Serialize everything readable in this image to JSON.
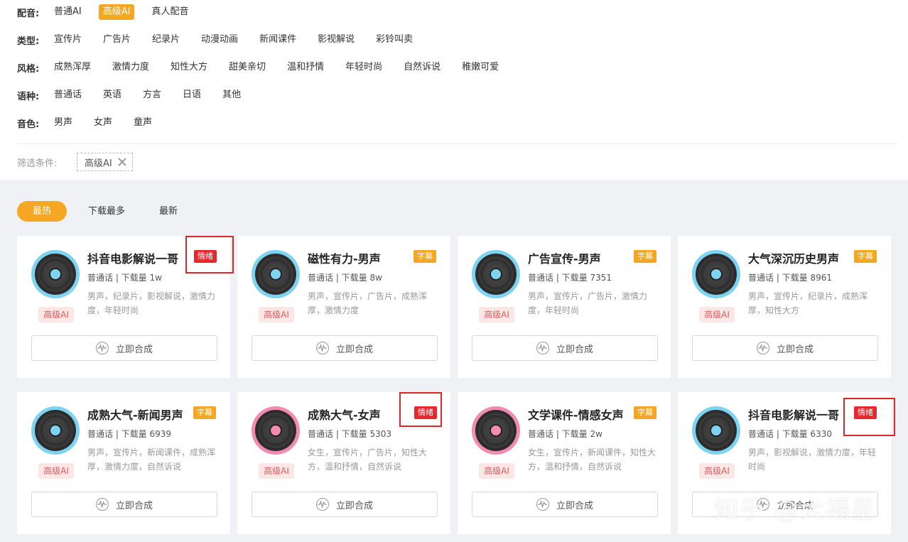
{
  "filters": {
    "voice": {
      "label": "配音:",
      "options": [
        "普通AI",
        "高级AI",
        "真人配音"
      ]
    },
    "type": {
      "label": "类型:",
      "options": [
        "宣传片",
        "广告片",
        "纪录片",
        "动漫动画",
        "新闻课件",
        "影视解说",
        "彩铃叫卖"
      ]
    },
    "style": {
      "label": "风格:",
      "options": [
        "成熟浑厚",
        "激情力度",
        "知性大方",
        "甜美亲切",
        "温和抒情",
        "年轻时尚",
        "自然诉说",
        "稚嫩可爱"
      ]
    },
    "language": {
      "label": "语种:",
      "options": [
        "普通话",
        "英语",
        "方言",
        "日语",
        "其他"
      ]
    },
    "timbre": {
      "label": "音色:",
      "options": [
        "男声",
        "女声",
        "童声"
      ]
    },
    "condition": {
      "label": "筛选条件:",
      "tag": "高级AI"
    }
  },
  "sort": {
    "options": [
      "最热",
      "下载最多",
      "最新"
    ]
  },
  "synth_label": "立即合成",
  "cards": [
    {
      "name": "抖音电影解说一哥",
      "badge": "情绪",
      "meta": "普通话 | 下载量 1w",
      "tags": "男声，纪录片，影视解说，激情力度，年轻时尚",
      "tier": "高级AI"
    },
    {
      "name": "磁性有力-男声",
      "badge": "字幕",
      "meta": "普通话 | 下载量 8w",
      "tags": "男声，宣传片，广告片，成熟浑厚，激情力度",
      "tier": "高级AI"
    },
    {
      "name": "广告宣传-男声",
      "badge": "字幕",
      "meta": "普通话 | 下载量 7351",
      "tags": "男声，宣传片，广告片，激情力度，年轻时尚",
      "tier": "高级AI"
    },
    {
      "name": "大气深沉历史男声",
      "badge": "字幕",
      "meta": "普通话 | 下载量 8961",
      "tags": "男声，宣传片，纪录片，成熟浑厚，知性大方",
      "tier": "高级AI"
    },
    {
      "name": "成熟大气-新闻男声",
      "badge": "字幕",
      "meta": "普通话 | 下载量 6939",
      "tags": "男声，宣传片，新闻课件，成熟浑厚，激情力度，自然诉说",
      "tier": "高级AI"
    },
    {
      "name": "成熟大气-女声",
      "badge": "情绪",
      "meta": "普通话 | 下载量 5303",
      "tags": "女生，宣传片，广告片，知性大方，温和抒情，自然诉说",
      "tier": "高级AI"
    },
    {
      "name": "文学课件-情感女声",
      "badge": "字幕",
      "meta": "普通话 | 下载量 2w",
      "tags": "女生，宣传片，新闻课件，知性大方，温和抒情，自然诉说",
      "tier": "高级AI"
    },
    {
      "name": "抖音电影解说一哥",
      "badge": "情绪",
      "meta": "普通话 | 下载量 6330",
      "tags": "男声，影视解说，激情力度，年轻时尚",
      "tier": "高级AI"
    }
  ],
  "watermark": "知乎 @大福星"
}
